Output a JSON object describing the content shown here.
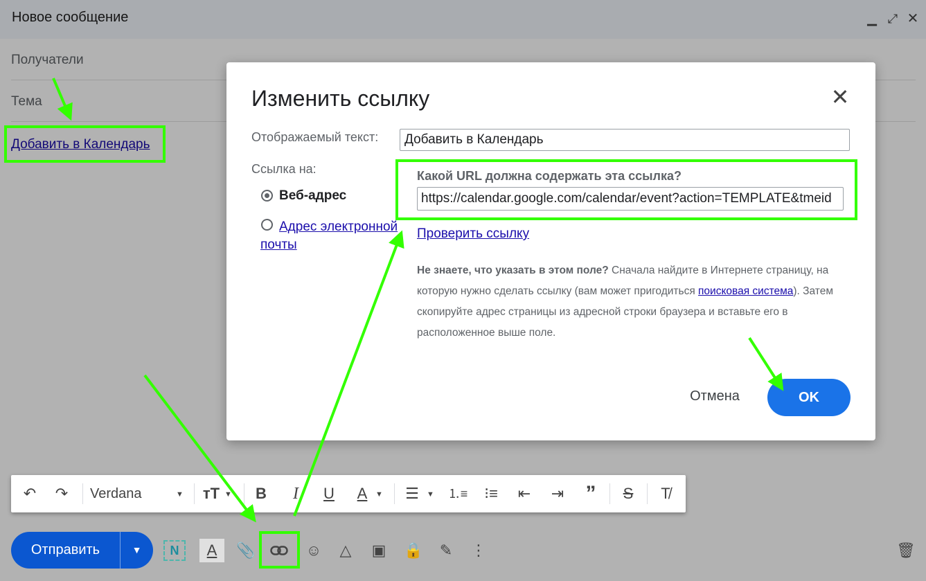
{
  "compose": {
    "title": "Новое сообщение",
    "recipients_label": "Получатели",
    "subject_label": "Тема",
    "body_link": "Добавить в Календарь"
  },
  "toolbar": {
    "font": "Verdana"
  },
  "bottom": {
    "send_label": "Отправить"
  },
  "dialog": {
    "title": "Изменить ссылку",
    "display_text_label": "Отображаемый текст:",
    "display_text_value": "Добавить в Календарь",
    "link_to_label": "Ссылка на:",
    "option_web": "Веб-адрес",
    "option_email": "Адрес электронной почты",
    "url_question": "Какой URL должна содержать эта ссылка?",
    "url_value": "https://calendar.google.com/calendar/event?action=TEMPLATE&tmeid",
    "check_link": "Проверить ссылку",
    "help_bold": "Не знаете, что указать в этом поле?",
    "help_part1": " Сначала найдите в Интернете страницу, на которую нужно сделать ссылку (вам может пригодиться ",
    "help_link": "поисковая система",
    "help_part2": "). Затем скопируйте адрес страницы из адресной строки браузера и вставьте его в расположенное выше поле.",
    "cancel": "Отмена",
    "ok": "OK"
  },
  "colors": {
    "accent": "#1a73e8",
    "send": "#0b57d0",
    "annotation": "#33ff00"
  }
}
